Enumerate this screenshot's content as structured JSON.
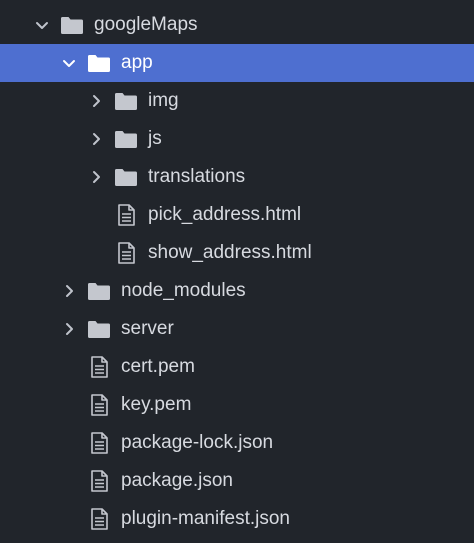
{
  "colors": {
    "background": "#21252b",
    "selection": "#4e6fd0",
    "text": "#d7dae0",
    "selected_text": "#ffffff",
    "icon": "#c4c7ce",
    "chevron": "#bfc3cb"
  },
  "file_tree": {
    "items": [
      {
        "label": "googleMaps",
        "type": "folder",
        "expanded": true,
        "depth": 0,
        "selected": false,
        "icon": "folder-icon"
      },
      {
        "label": "app",
        "type": "folder",
        "expanded": true,
        "depth": 1,
        "selected": true,
        "icon": "folder-icon"
      },
      {
        "label": "img",
        "type": "folder",
        "expanded": false,
        "depth": 2,
        "selected": false,
        "icon": "folder-icon"
      },
      {
        "label": "js",
        "type": "folder",
        "expanded": false,
        "depth": 2,
        "selected": false,
        "icon": "folder-icon"
      },
      {
        "label": "translations",
        "type": "folder",
        "expanded": false,
        "depth": 2,
        "selected": false,
        "icon": "folder-icon"
      },
      {
        "label": "pick_address.html",
        "type": "file",
        "depth": 2,
        "selected": false,
        "icon": "file-text-icon"
      },
      {
        "label": "show_address.html",
        "type": "file",
        "depth": 2,
        "selected": false,
        "icon": "file-text-icon"
      },
      {
        "label": "node_modules",
        "type": "folder",
        "expanded": false,
        "depth": 1,
        "selected": false,
        "icon": "folder-icon"
      },
      {
        "label": "server",
        "type": "folder",
        "expanded": false,
        "depth": 1,
        "selected": false,
        "icon": "folder-icon"
      },
      {
        "label": "cert.pem",
        "type": "file",
        "depth": 1,
        "selected": false,
        "icon": "file-text-icon"
      },
      {
        "label": "key.pem",
        "type": "file",
        "depth": 1,
        "selected": false,
        "icon": "file-text-icon"
      },
      {
        "label": "package-lock.json",
        "type": "file",
        "depth": 1,
        "selected": false,
        "icon": "file-text-icon"
      },
      {
        "label": "package.json",
        "type": "file",
        "depth": 1,
        "selected": false,
        "icon": "file-text-icon"
      },
      {
        "label": "plugin-manifest.json",
        "type": "file",
        "depth": 1,
        "selected": false,
        "icon": "file-text-icon"
      }
    ]
  }
}
